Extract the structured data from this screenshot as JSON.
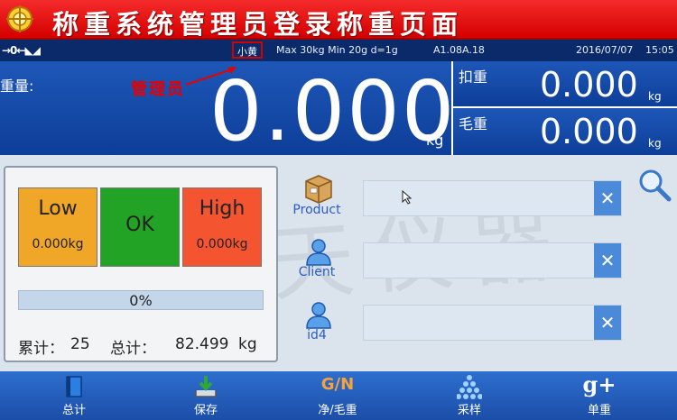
{
  "banner": {
    "title": "称重系统管理员登录称重页面"
  },
  "status": {
    "signal": "→0←◣◢",
    "user": "小黄",
    "spec": "Max 30kg  Min 20g  d=1g",
    "firmware": "A1.08A.18",
    "date": "2016/07/07",
    "time": "15:05"
  },
  "weight": {
    "label": "重量:",
    "value": "0.000",
    "unit": "kg",
    "annotation": "管理员"
  },
  "tare": {
    "label": "扣重",
    "value": "0.000",
    "unit": "kg"
  },
  "gross": {
    "label": "毛重",
    "value": "0.000",
    "unit": "kg"
  },
  "limits": {
    "low": {
      "label": "Low",
      "value": "0.000kg"
    },
    "ok": {
      "label": "OK"
    },
    "high": {
      "label": "High",
      "value": "0.000kg"
    }
  },
  "progress": {
    "percent_text": "0%",
    "fraction": 0
  },
  "totals": {
    "count_label": "累计：",
    "count_value": "25",
    "total_label": "总计：",
    "total_value": "82.499",
    "total_unit": "kg"
  },
  "fields": [
    {
      "label": "Product",
      "value": "",
      "clear": "✕",
      "icon": "product-box-icon"
    },
    {
      "label": "Client",
      "value": "",
      "clear": "✕",
      "icon": "user-icon"
    },
    {
      "label": "id4",
      "value": "",
      "clear": "✕",
      "icon": "user-icon"
    }
  ],
  "toolbar": [
    {
      "label": "总计",
      "icon": "book-icon"
    },
    {
      "label": "保存",
      "icon": "save-download-icon"
    },
    {
      "label": "净/毛重",
      "icon": "gn-text-icon",
      "icon_text": "G/N"
    },
    {
      "label": "采样",
      "icon": "stack-dots-icon"
    },
    {
      "label": "单重",
      "icon": "g-plus-icon",
      "icon_text": "g+"
    }
  ],
  "watermark": "巨天仪器",
  "colors": {
    "banner": "#e00000",
    "display_blue": "#1a4fae",
    "low": "#f0a626",
    "ok": "#23a325",
    "high": "#f4542f",
    "accent": "#4a8ad8"
  }
}
